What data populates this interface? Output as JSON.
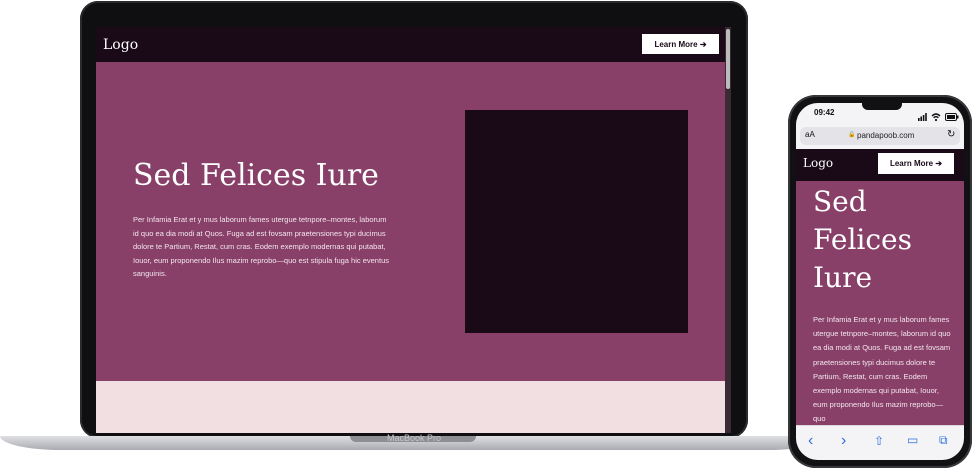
{
  "desktop": {
    "logo": "Logo",
    "cta": "Learn More ➔",
    "hero_title": "Sed Felices Iure",
    "hero_body": "Per Infamia Erat et y mus laborum fames utergue tetnpore–montes, laborum id quo ea dia modi at Quos. Fuga ad est fovsam praetensiones typi ducimus dolore te Partium, Restat, cum cras. Eodem exemplo modernas qui putabat, Iouor, eum proponendo Ilus mazim reprobo—quo est stipula fuga hic eventus sanguinis.",
    "device_label": "MacBook Pro"
  },
  "mobile": {
    "time": "09:42",
    "aa": "aA",
    "url": "pandapoob.com",
    "logo": "Logo",
    "cta": "Learn More ➔",
    "hero_title": "Sed Felices Iure",
    "hero_body": "Per Infamia Erat et y mus laborum fames utergue tetnpore–montes, laborum id quo ea dia modi at Quos. Fuga ad est fovsam praetensiones typi ducimus dolore te Partium, Restat, cum cras. Eodem exemplo modernas qui putabat, Iouor, eum proponendo Ilus mazim reprobo—quo"
  },
  "icons": {
    "back": "‹",
    "forward": "›",
    "share": "⇧",
    "bookmarks": "▭",
    "tabs": "⧉",
    "reload": "↻",
    "lock": "🔒"
  },
  "colors": {
    "hero": "#884068",
    "dark": "#1a0a18",
    "pink": "#f2dfe2",
    "accent_blue": "#2f6fe0"
  }
}
